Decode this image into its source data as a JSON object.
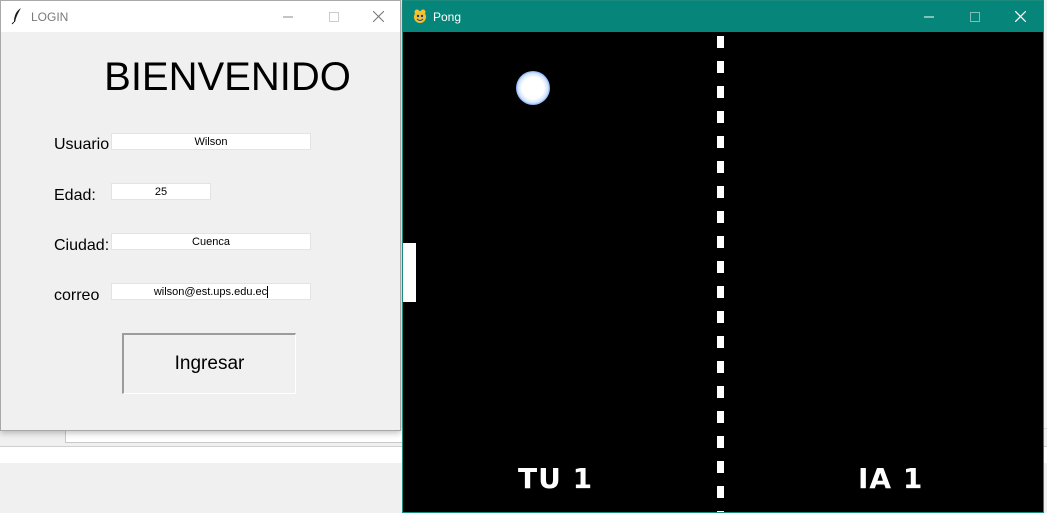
{
  "login_window": {
    "title": "LOGIN",
    "heading": "BIENVENIDO",
    "fields": [
      {
        "label": "Usuario",
        "value": "Wilson"
      },
      {
        "label": "Edad:",
        "value": "25"
      },
      {
        "label": "Ciudad:",
        "value": "Cuenca"
      },
      {
        "label": "correo",
        "value": "wilson@est.ups.edu.ec"
      }
    ],
    "submit_label": "Ingresar"
  },
  "pong_window": {
    "title": "Pong",
    "player_score_label": "TU 1",
    "ai_score_label": "IA 1",
    "titlebar_color": "#06867a"
  },
  "window_controls": {
    "minimize": "—",
    "maximize": "☐",
    "close": "✕"
  }
}
